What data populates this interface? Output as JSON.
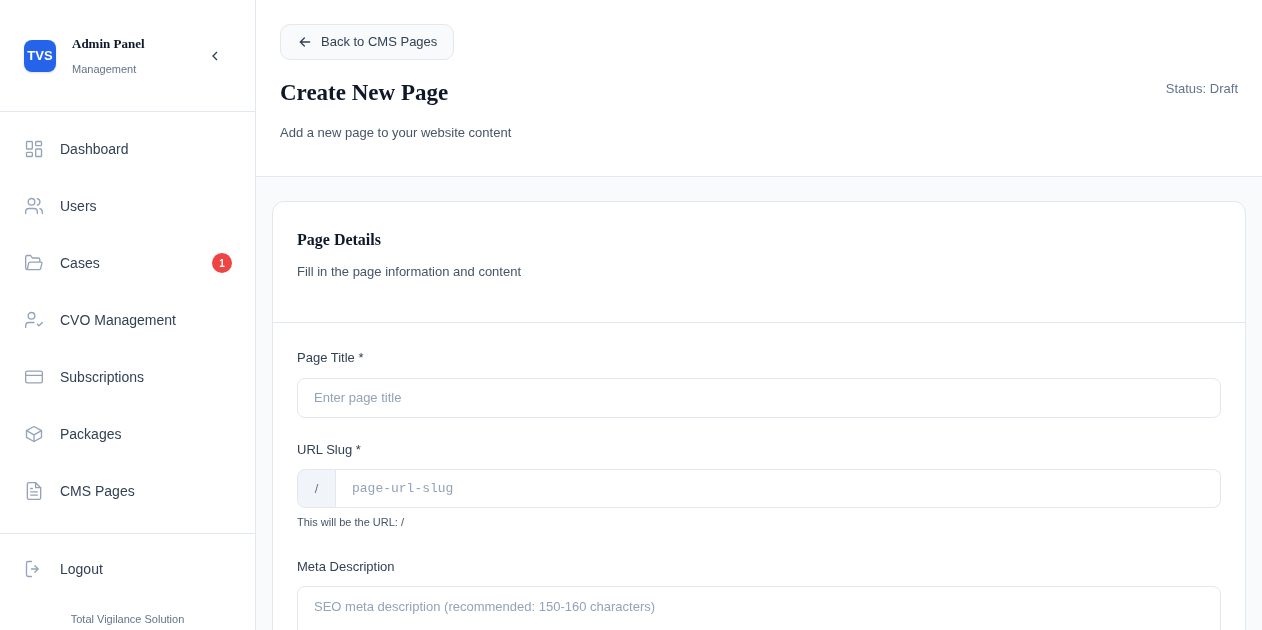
{
  "sidebar": {
    "logo": "TVS",
    "title": "Admin Panel",
    "subtitle": "Management",
    "items": [
      {
        "label": "Dashboard"
      },
      {
        "label": "Users"
      },
      {
        "label": "Cases",
        "badge": "1"
      },
      {
        "label": "CVO Management"
      },
      {
        "label": "Subscriptions"
      },
      {
        "label": "Packages"
      },
      {
        "label": "CMS Pages"
      }
    ],
    "logout": "Logout",
    "footer": "Total Vigilance Solution"
  },
  "header": {
    "back": "Back to CMS Pages",
    "title": "Create New Page",
    "subtitle": "Add a new page to your website content",
    "status": "Status: Draft"
  },
  "card": {
    "title": "Page Details",
    "subtitle": "Fill in the page information and content",
    "fields": [
      {
        "kind": "text",
        "label": "Page Title *",
        "placeholder": "Enter page title"
      },
      {
        "kind": "slug",
        "label": "URL Slug *",
        "prefix": "/",
        "placeholder": "page-url-slug",
        "hint": "This will be the URL: /"
      },
      {
        "kind": "textarea",
        "label": "Meta Description",
        "placeholder": "SEO meta description (recommended: 150-160 characters)"
      }
    ]
  }
}
